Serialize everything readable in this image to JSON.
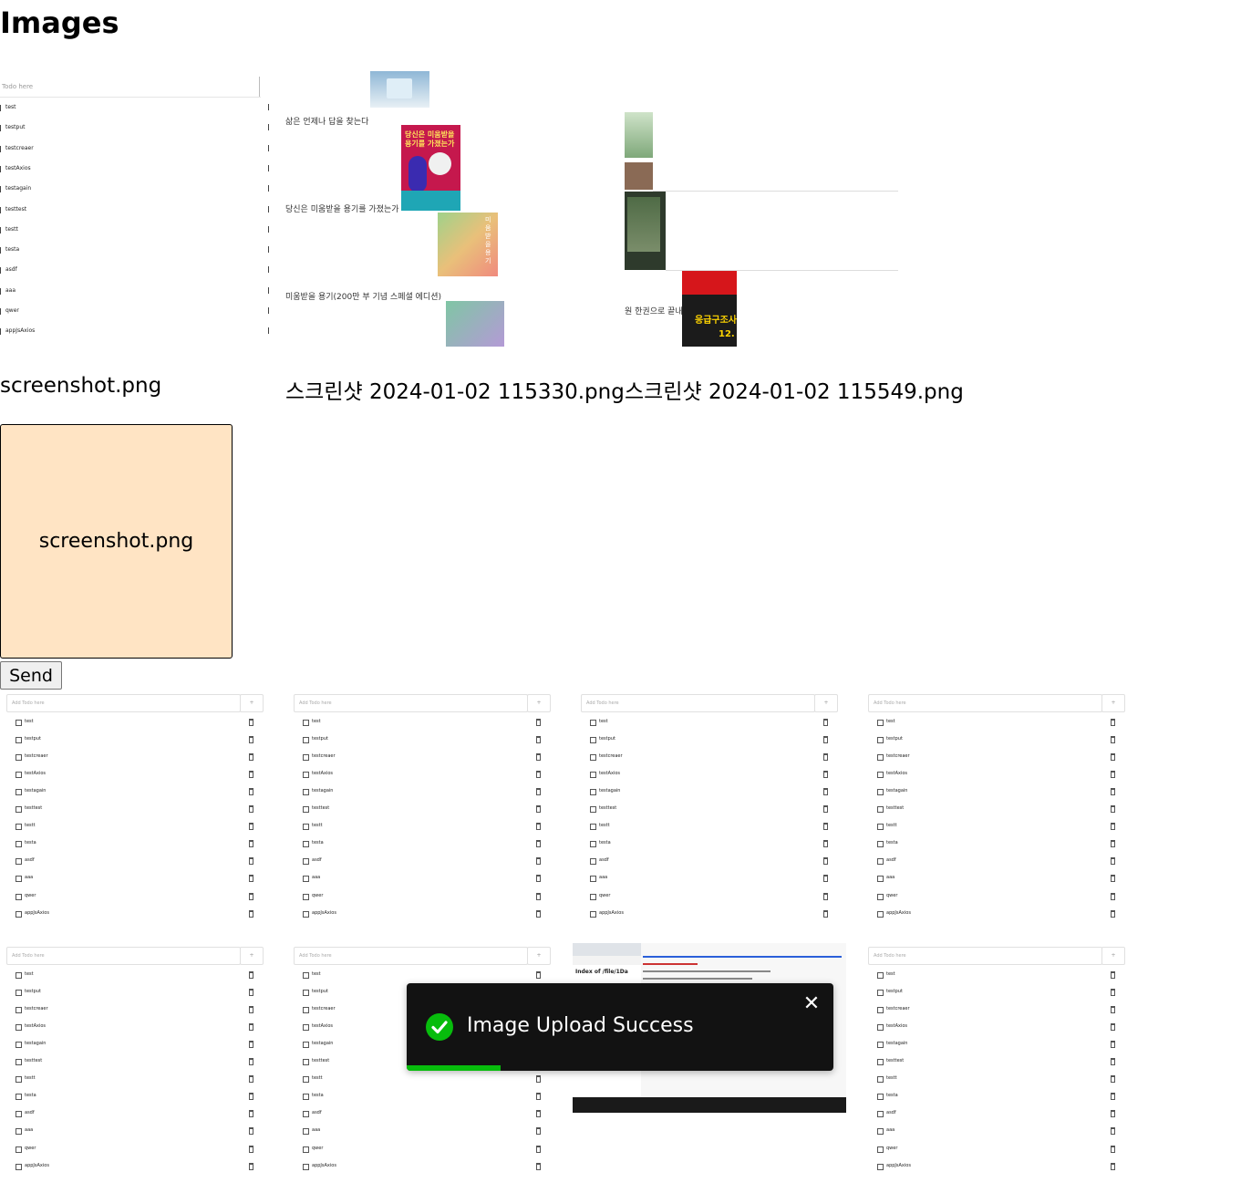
{
  "page": {
    "title": "Images"
  },
  "previews": [
    {
      "filename": "screenshot.png"
    },
    {
      "filename": "스크린샷 2024-01-02 115330.png"
    },
    {
      "filename": "스크린샷 2024-01-02 115549.png"
    }
  ],
  "todo_mini": {
    "placeholder": "Todo here",
    "items": [
      "test",
      "testput",
      "testcreaer",
      "testAxios",
      "testagain",
      "testtest",
      "testt",
      "testa",
      "asdf",
      "aaa",
      "qwer",
      "appJsAxios"
    ]
  },
  "book_texts": [
    "삶은 언제나 답을 찾는다",
    "당신은 미움받을 용기를 가졌는가",
    "미움받을 용기(200만 부 기념 스페셜 에디션)",
    "원 한권으로 끝내기"
  ],
  "book_covers": {
    "courage_title": "당신은 미움받을 용기를 가졌는가",
    "courage_vertical": "미움받을 용기",
    "emergency_title": "응급구조사",
    "emergency_number": "12."
  },
  "dropzone": {
    "filename": "screenshot.png"
  },
  "send_label": "Send",
  "gallery_todo": {
    "placeholder": "Add Todo here",
    "add_label": "+",
    "items": [
      "test",
      "testput",
      "testcreaer",
      "testAxios",
      "testagain",
      "testtest",
      "testt",
      "testa",
      "asdf",
      "aaa",
      "qwer",
      "appJsAxios"
    ]
  },
  "screenshot_thumb": {
    "heading": "Index of /file/1Da"
  },
  "toast": {
    "message": "Image Upload Success",
    "close": "✕",
    "progress": 0.22,
    "color": "#07bc0c"
  }
}
